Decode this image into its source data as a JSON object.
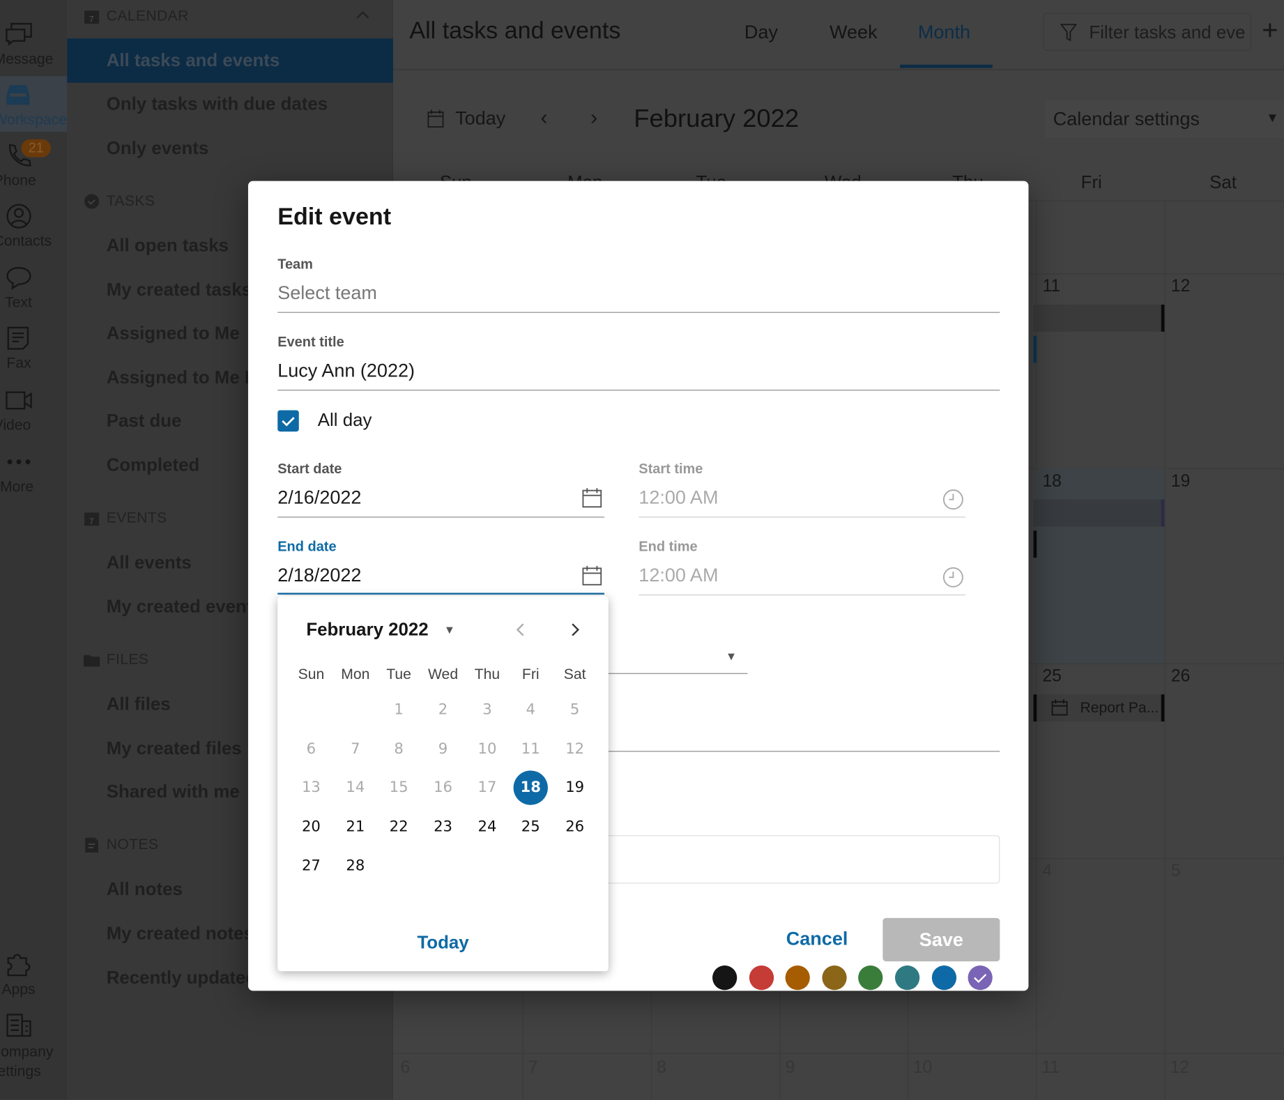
{
  "rail": {
    "items": [
      {
        "label": "Message",
        "icon": "message-icon"
      },
      {
        "label": "Workspace",
        "icon": "inbox-icon",
        "active": true
      },
      {
        "label": "Phone",
        "icon": "phone-icon",
        "badge": "21"
      },
      {
        "label": "Contacts",
        "icon": "contacts-icon"
      },
      {
        "label": "Text",
        "icon": "chat-bubble-icon"
      },
      {
        "label": "Fax",
        "icon": "fax-icon"
      },
      {
        "label": "Video",
        "icon": "video-icon"
      },
      {
        "label": "More",
        "icon": "more-icon"
      },
      {
        "label": "Apps",
        "icon": "puzzle-icon"
      },
      {
        "label": "Company settings",
        "icon": "building-icon"
      }
    ]
  },
  "sidebar": {
    "calendar": {
      "title": "CALENDAR",
      "items": [
        "All tasks and events",
        "Only tasks with due dates",
        "Only events"
      ]
    },
    "tasks": {
      "title": "TASKS",
      "items": [
        "All open tasks",
        "My created tasks",
        "Assigned to Me",
        "Assigned to Me D",
        "Past due",
        "Completed"
      ]
    },
    "events": {
      "title": "EVENTS",
      "items": [
        "All events",
        "My created event"
      ]
    },
    "files": {
      "title": "FILES",
      "items": [
        "All files",
        "My created files",
        "Shared with me"
      ]
    },
    "notes": {
      "title": "NOTES",
      "items": [
        "All notes",
        "My created notes",
        "Recently updated"
      ]
    }
  },
  "header": {
    "title": "All tasks and events",
    "tabs": [
      "Day",
      "Week",
      "Month"
    ],
    "active_tab": "Month",
    "filter_placeholder": "Filter tasks and eve",
    "add": "+"
  },
  "toolbar": {
    "today": "Today",
    "prev": "‹",
    "next": "›",
    "month": "February 2022",
    "settings": "Calendar settings"
  },
  "calendar": {
    "weekdays": [
      "Sun",
      "Mon",
      "Tue",
      "Wed",
      "Thu",
      "Fri",
      "Sat"
    ],
    "visible_days": {
      "fri": [
        "11",
        "18",
        "25",
        "4"
      ],
      "sat": [
        "12",
        "19",
        "26",
        "5"
      ]
    },
    "last_row": [
      "6",
      "7",
      "8",
      "9",
      "10",
      "11",
      "12"
    ],
    "event_label": "Report Pa..."
  },
  "modal": {
    "title": "Edit event",
    "team_label": "Team",
    "team_placeholder": "Select team",
    "event_title_label": "Event title",
    "event_title": "Lucy Ann (2022)",
    "all_day_label": "All day",
    "all_day": true,
    "start_date_label": "Start date",
    "start_date": "2/16/2022",
    "start_time_label": "Start time",
    "start_time": "12:00 AM",
    "end_date_label": "End date",
    "end_date": "2/18/2022",
    "end_time_label": "End time",
    "end_time": "12:00 AM",
    "colors": [
      "#151515",
      "#c53b36",
      "#a65c00",
      "#8b6518",
      "#3a7d3b",
      "#2f7a82",
      "#0e6aa6",
      "#7a64b5"
    ],
    "selected_color": "#7a64b5",
    "cancel": "Cancel",
    "save": "Save"
  },
  "datepicker": {
    "month": "February 2022",
    "weekdays": [
      "Sun",
      "Mon",
      "Tue",
      "Wed",
      "Thu",
      "Fri",
      "Sat"
    ],
    "days": [
      "1",
      "2",
      "3",
      "4",
      "5",
      "6",
      "7",
      "8",
      "9",
      "10",
      "11",
      "12",
      "13",
      "14",
      "15",
      "16",
      "17",
      "18",
      "19",
      "20",
      "21",
      "22",
      "23",
      "24",
      "25",
      "26",
      "27",
      "28"
    ],
    "first_weekday": 2,
    "disabled_before": 18,
    "selected": "18",
    "today": "Today"
  },
  "colors": {
    "accent": "#0e6aa6",
    "save_disabled": "#b8b8b8"
  }
}
